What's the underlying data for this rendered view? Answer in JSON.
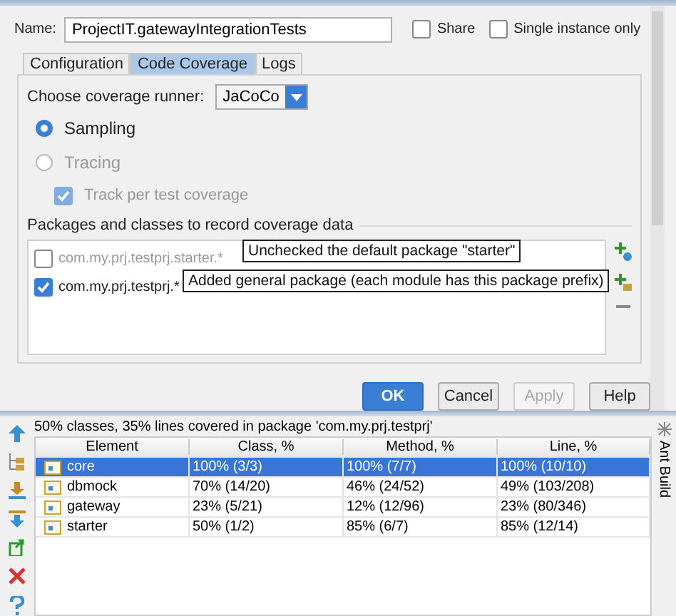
{
  "dialog": {
    "name_field": {
      "label": "Name:",
      "value": "ProjectIT.gatewayIntegrationTests"
    },
    "share": {
      "label": "Share",
      "checked": false
    },
    "single_instance": {
      "label": "Single instance only",
      "checked": false
    },
    "tabs": [
      {
        "label": "Configuration",
        "selected": false
      },
      {
        "label": "Code Coverage",
        "selected": true
      },
      {
        "label": "Logs",
        "selected": false
      }
    ],
    "coverage_runner": {
      "label": "Choose coverage runner:",
      "value": "JaCoCo"
    },
    "modes": [
      {
        "label": "Sampling",
        "selected": true,
        "disabled": false
      },
      {
        "label": "Tracing",
        "selected": false,
        "disabled": true
      }
    ],
    "track_per_test": {
      "label": "Track per test coverage",
      "checked": true,
      "disabled": true
    },
    "packages": {
      "label": "Packages and classes to record coverage data",
      "items": [
        {
          "pattern": "com.my.prj.testprj.starter.*",
          "checked": false
        },
        {
          "pattern": "com.my.prj.testprj.*",
          "checked": true
        }
      ]
    },
    "annotations": [
      "Unchecked the default package \"starter\"",
      "Added general package (each module has this package prefix)"
    ],
    "buttons": [
      {
        "label": "OK",
        "default": true,
        "disabled": false
      },
      {
        "label": "Cancel",
        "default": false,
        "disabled": false
      },
      {
        "label": "Apply",
        "default": false,
        "disabled": true
      },
      {
        "label": "Help",
        "default": false,
        "disabled": false
      }
    ]
  },
  "coverage": {
    "summary": "50% classes, 35% lines covered in package 'com.my.prj.testprj'",
    "columns": [
      "Element",
      "Class, %",
      "Method, %",
      "Line, %"
    ],
    "rows": [
      {
        "element": "core",
        "class": "100% (3/3)",
        "method": "100% (7/7)",
        "line": "100% (10/10)",
        "selected": true
      },
      {
        "element": "dbmock",
        "class": "70% (14/20)",
        "method": "46% (24/52)",
        "line": "49% (103/208)",
        "selected": false
      },
      {
        "element": "gateway",
        "class": "23% (5/21)",
        "method": "12% (12/96)",
        "line": "23% (80/346)",
        "selected": false
      },
      {
        "element": "starter",
        "class": "50% (1/2)",
        "method": "85% (6/7)",
        "line": "85% (12/14)",
        "selected": false
      }
    ],
    "side_tab": "Ant Build"
  }
}
